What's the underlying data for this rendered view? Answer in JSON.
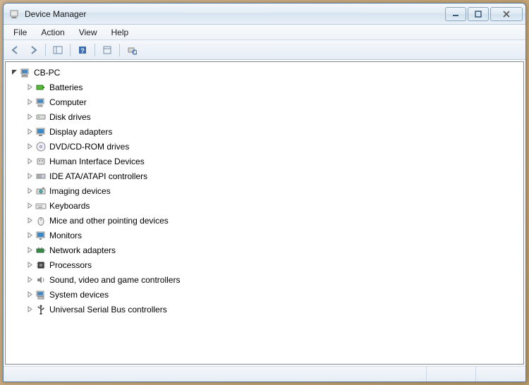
{
  "window": {
    "title": "Device Manager"
  },
  "menubar": {
    "items": [
      "File",
      "Action",
      "View",
      "Help"
    ]
  },
  "tree": {
    "root": {
      "label": "CB-PC",
      "expanded": true,
      "children": [
        {
          "label": "Batteries",
          "icon": "battery"
        },
        {
          "label": "Computer",
          "icon": "computer"
        },
        {
          "label": "Disk drives",
          "icon": "disk"
        },
        {
          "label": "Display adapters",
          "icon": "display"
        },
        {
          "label": "DVD/CD-ROM drives",
          "icon": "dvd"
        },
        {
          "label": "Human Interface Devices",
          "icon": "hid"
        },
        {
          "label": "IDE ATA/ATAPI controllers",
          "icon": "ide"
        },
        {
          "label": "Imaging devices",
          "icon": "imaging"
        },
        {
          "label": "Keyboards",
          "icon": "keyboard"
        },
        {
          "label": "Mice and other pointing devices",
          "icon": "mouse"
        },
        {
          "label": "Monitors",
          "icon": "monitor"
        },
        {
          "label": "Network adapters",
          "icon": "network"
        },
        {
          "label": "Processors",
          "icon": "cpu"
        },
        {
          "label": "Sound, video and game controllers",
          "icon": "sound"
        },
        {
          "label": "System devices",
          "icon": "system"
        },
        {
          "label": "Universal Serial Bus controllers",
          "icon": "usb"
        }
      ]
    }
  }
}
